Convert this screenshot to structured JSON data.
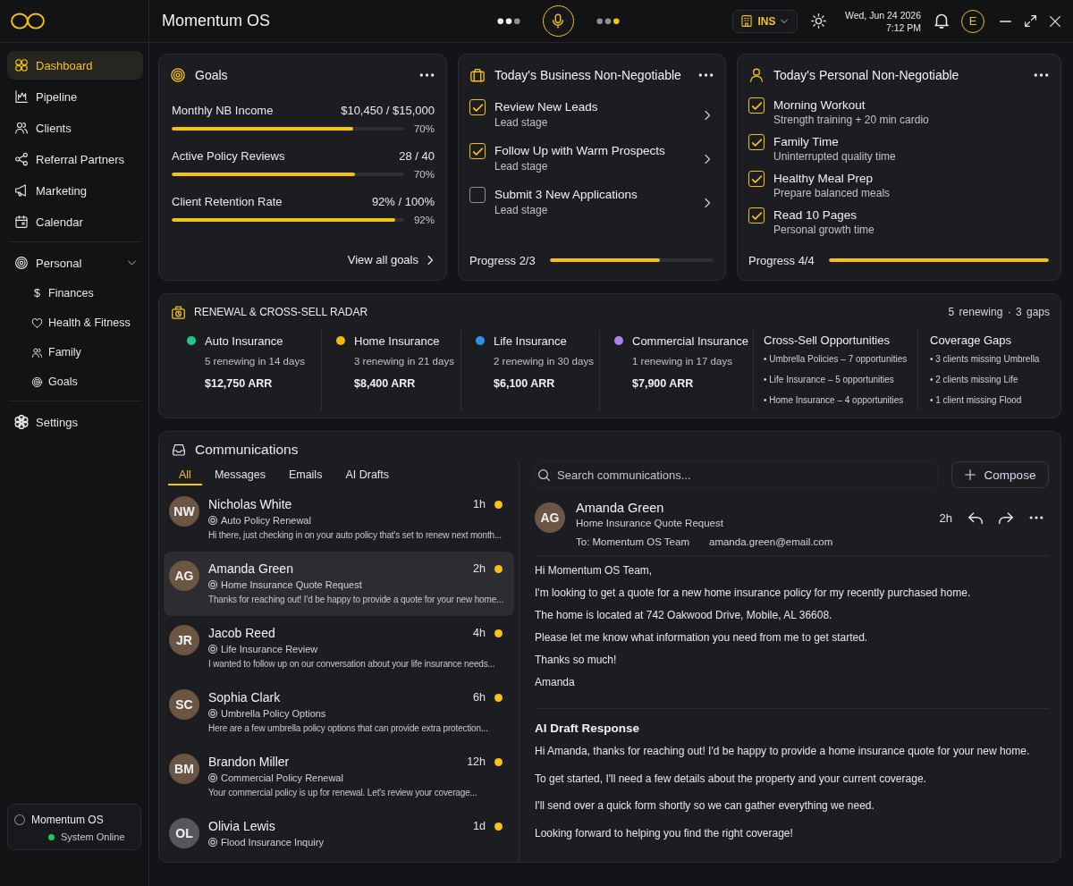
{
  "topbar": {
    "title": "Momentum OS",
    "workspace": "INS",
    "date": "Wed, Jun 24 2026",
    "time": "7:12 PM",
    "user_initial": "E"
  },
  "sidebar": {
    "sections": [
      {
        "items": [
          {
            "label": "Dashboard",
            "selected": true
          },
          {
            "label": "Pipeline",
            "selected": false
          },
          {
            "label": "Clients",
            "selected": false
          },
          {
            "label": "Referral Partners",
            "selected": false
          },
          {
            "label": "Marketing",
            "selected": false
          },
          {
            "label": "Calendar",
            "selected": false
          }
        ]
      },
      {
        "items": [
          {
            "label": "Personal",
            "selected": false,
            "expanded": true,
            "children": [
              {
                "label": "Finances",
                "glyph": "$",
                "selected": false
              },
              {
                "label": "Health & Fitness",
                "selected": false
              },
              {
                "label": "Family",
                "selected": false
              },
              {
                "label": "Goals",
                "selected": false
              }
            ]
          }
        ]
      },
      {
        "items": [
          {
            "label": "Settings",
            "selected": false
          }
        ]
      }
    ],
    "status": {
      "title": "Momentum OS",
      "text": "System Online",
      "online": true
    }
  },
  "goals": {
    "title": "Goals",
    "rows": [
      {
        "label": "Monthly NB Income",
        "value": "$10,450 / $15,000",
        "level": 0.78,
        "percent": "70%"
      },
      {
        "label": "Active Policy Reviews",
        "value": "28 / 40",
        "level": 0.79,
        "percent": "70%"
      },
      {
        "label": "Client Retention Rate",
        "value": "92% / 100%",
        "level": 0.96,
        "percent": "92%"
      }
    ],
    "link": "View all goals"
  },
  "business": {
    "title": "Today's Business Non-Negotiable",
    "tasks": [
      {
        "title": "Review New Leads",
        "subtitle": "Lead stage",
        "checked": true
      },
      {
        "title": "Follow Up with Warm Prospects",
        "subtitle": "Lead stage",
        "checked": true
      },
      {
        "title": "Submit 3 New Applications",
        "subtitle": "Lead stage",
        "checked": false
      }
    ],
    "progress": "Progress 2/3",
    "level": 0.67
  },
  "personal": {
    "title": "Today's Personal Non-Negotiable",
    "tasks": [
      {
        "title": "Morning Workout",
        "subtitle": "Strength training + 20 min cardio",
        "checked": true
      },
      {
        "title": "Family Time",
        "subtitle": "Uninterrupted quality time",
        "checked": true
      },
      {
        "title": "Healthy Meal Prep",
        "subtitle": "Prepare balanced meals",
        "checked": true
      },
      {
        "title": "Read 10 Pages",
        "subtitle": "Personal growth time",
        "checked": true
      }
    ],
    "progress": "Progress 4/4",
    "level": 1
  },
  "radar": {
    "title": "RENEWAL & CROSS-SELL RADAR",
    "summary": "5 renewing · 3 gaps",
    "lines": [
      {
        "name": "Auto Insurance",
        "color": "#1fc98e",
        "detail": "5 renewing in 14 days",
        "arr": "$12,750 ARR"
      },
      {
        "name": "Home Insurance",
        "color": "#f5b800",
        "detail": "3 renewing in 21 days",
        "arr": "$8,400 ARR"
      },
      {
        "name": "Life Insurance",
        "color": "#2f8fec",
        "detail": "2 renewing in 30 days",
        "arr": "$6,100 ARR"
      },
      {
        "name": "Commercial Insurance",
        "color": "#a784e8",
        "detail": "1 renewing in 17 days",
        "arr": "$7,900 ARR"
      }
    ],
    "cross_sell": {
      "title": "Cross-Sell Opportunities",
      "items": [
        "• Umbrella Policies – 7 opportunities",
        "• Life Insurance – 5 opportunities",
        "• Home Insurance – 4 opportunities"
      ]
    },
    "coverage_gaps": {
      "title": "Coverage Gaps",
      "items": [
        "• 3 clients missing Umbrella",
        "• 2 clients missing Life",
        "• 1 client missing Flood"
      ]
    }
  },
  "communications": {
    "title": "Communications",
    "tabs": [
      {
        "label": "All",
        "selected": true
      },
      {
        "label": "Messages",
        "selected": false
      },
      {
        "label": "Emails",
        "selected": false
      },
      {
        "label": "AI Drafts",
        "selected": false
      }
    ],
    "messages": [
      {
        "initials": "NW",
        "color": "#6b5544",
        "name": "Nicholas White",
        "time": "1h",
        "unread": true,
        "subject": "Auto Policy Renewal",
        "preview": "Hi there, just checking in on your auto policy that's set to renew next month...",
        "selected": false
      },
      {
        "initials": "AG",
        "color": "#6b5544",
        "name": "Amanda Green",
        "time": "2h",
        "unread": true,
        "subject": "Home Insurance Quote Request",
        "preview": "Thanks for reaching out! I'd be happy to provide a quote for your new home...",
        "selected": true
      },
      {
        "initials": "JR",
        "color": "#6b5544",
        "name": "Jacob Reed",
        "time": "4h",
        "unread": true,
        "subject": "Life Insurance Review",
        "preview": "I wanted to follow up on our conversation about your life insurance needs...",
        "selected": false
      },
      {
        "initials": "SC",
        "color": "#6b5544",
        "name": "Sophia Clark",
        "time": "6h",
        "unread": true,
        "subject": "Umbrella Policy Options",
        "preview": "Here are a few umbrella policy options that can provide extra protection...",
        "selected": false
      },
      {
        "initials": "BM",
        "color": "#6b5544",
        "name": "Brandon Miller",
        "time": "12h",
        "unread": true,
        "subject": "Commercial Policy Renewal",
        "preview": "Your commercial policy is up for renewal. Let's review your coverage...",
        "selected": false
      },
      {
        "initials": "OL",
        "color": "#56565b",
        "name": "Olivia Lewis",
        "time": "1d",
        "unread": true,
        "subject": "Flood Insurance Inquiry",
        "selected": false
      }
    ],
    "search": {
      "placeholder": "Search communications..."
    },
    "compose": "Compose",
    "detail": {
      "initials": "AG",
      "color": "#6b5544",
      "name": "Amanda Green",
      "subject": "Home Insurance Quote Request",
      "to": "To: Momentum OS Team",
      "email": "amanda.green@email.com",
      "time": "2h",
      "body": [
        "Hi Momentum OS Team,",
        "I'm looking to get a quote for a new home insurance policy for my recently purchased home.",
        "The home is located at 742 Oakwood Drive, Mobile, AL 36608.",
        "Please let me know what information you need from me to get started.",
        "Thanks so much!",
        "Amanda"
      ],
      "draft": {
        "title": "AI Draft Response",
        "body": [
          "Hi Amanda, thanks for reaching out! I'd be happy to provide a home insurance quote for your new home.",
          "To get started, I'll need a few details about the property and your current coverage.",
          "I'll send over a quick form shortly so we can gather everything we need.",
          "Looking forward to helping you find the right coverage!"
        ]
      }
    }
  }
}
